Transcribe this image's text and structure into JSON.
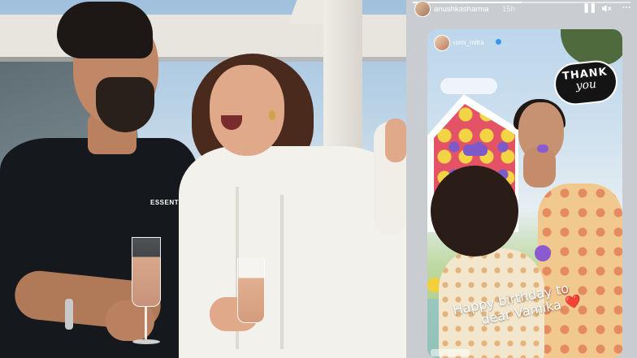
{
  "story": {
    "username": "anushkasharma",
    "time": "15h",
    "progress": 0.5,
    "controls": {
      "pause_icon": "pause-icon",
      "mute_icon": "mute-icon",
      "more_icon": "more-icon"
    },
    "reshared_card": {
      "username": "romi_mitra",
      "sticker_line1": "THANK",
      "sticker_line2": "you",
      "caption_line1": "Happy birthday to",
      "caption_line2": "dear Vamika",
      "caption_emoji": "❤️"
    }
  },
  "left_photo": {
    "shirt_logo": "ESSENTIAL"
  },
  "colors": {
    "story_bg": "#c9cdd2",
    "heart": "#e3243b",
    "verified": "#3897f0"
  }
}
